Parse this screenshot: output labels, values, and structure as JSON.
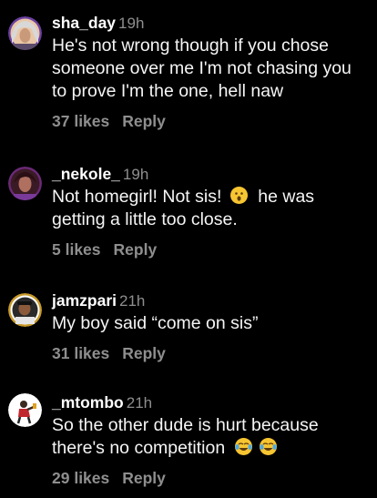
{
  "comments": [
    {
      "username": "sha_day",
      "time": "19h",
      "text": "He's not wrong though if you chose someone over me I'm not chasing you to prove I'm the one, hell naw",
      "likes": "37 likes",
      "reply": "Reply",
      "avatar_icon": "avatar-sha_day"
    },
    {
      "username": "_nekole_",
      "time": "19h",
      "text": "Not homegirl! Not sis!",
      "text_after": "he was getting a little too close.",
      "emoji": "hushed-face-emoji",
      "likes": "5 likes",
      "reply": "Reply",
      "avatar_icon": "avatar-_nekole_"
    },
    {
      "username": "jamzpari",
      "time": "21h",
      "text": "My boy said “come on sis”",
      "likes": "31 likes",
      "reply": "Reply",
      "avatar_icon": "avatar-jamzpari"
    },
    {
      "username": "_mtombo",
      "time": "21h",
      "text": "So the other dude is hurt because there's no competition",
      "emoji": "tears-of-joy-emoji",
      "likes": "29 likes",
      "reply": "Reply",
      "avatar_icon": "avatar-_mtombo"
    }
  ],
  "colors": {
    "background": "#000000",
    "primary_text": "#ffffff",
    "secondary_text": "#8e8e8e",
    "emoji_yellow": "#f7c531"
  }
}
